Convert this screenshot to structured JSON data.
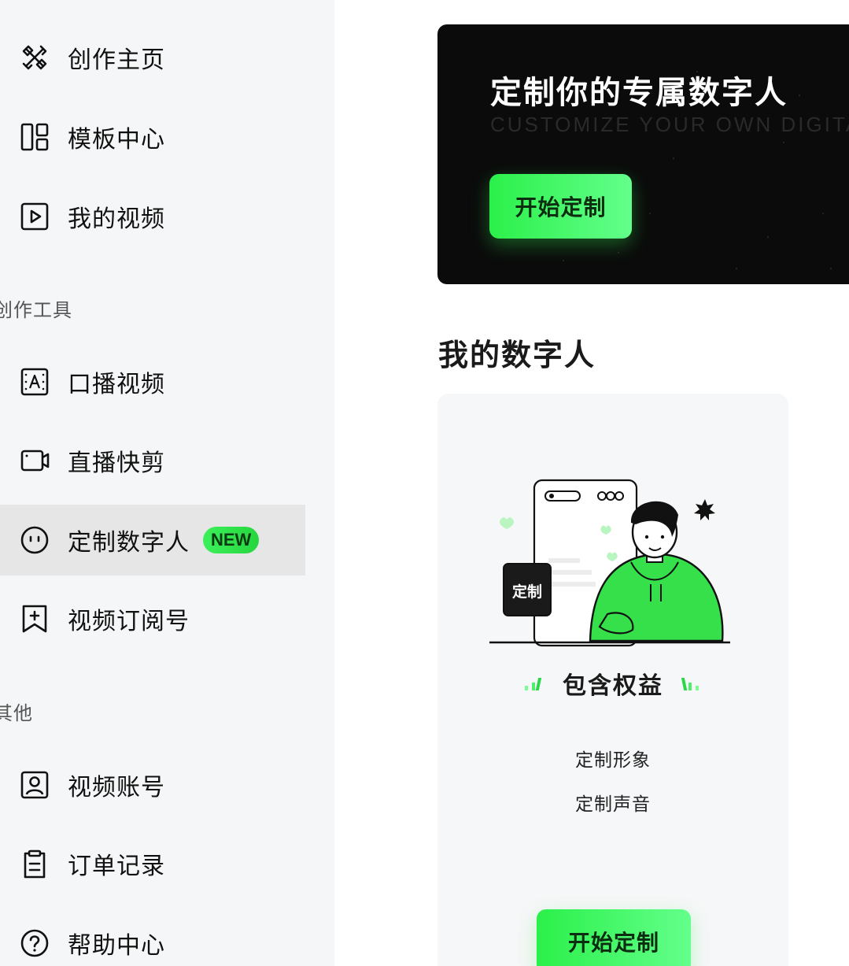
{
  "sidebar": {
    "top_items": [
      {
        "label": "创作主页",
        "icon": "creation-home-icon"
      },
      {
        "label": "模板中心",
        "icon": "template-grid-icon"
      },
      {
        "label": "我的视频",
        "icon": "play-video-icon"
      }
    ],
    "sections": [
      {
        "title": "创作工具",
        "items": [
          {
            "label": "口播视频",
            "icon": "talking-video-icon"
          },
          {
            "label": "直播快剪",
            "icon": "live-clip-camera-icon"
          },
          {
            "label": "定制数字人",
            "icon": "digital-human-face-icon",
            "badge": "NEW",
            "active": true
          },
          {
            "label": "视频订阅号",
            "icon": "bookmark-plus-icon"
          }
        ]
      },
      {
        "title": "其他",
        "items": [
          {
            "label": "视频账号",
            "icon": "account-person-icon"
          },
          {
            "label": "订单记录",
            "icon": "clipboard-order-icon"
          },
          {
            "label": "帮助中心",
            "icon": "help-question-icon"
          }
        ]
      }
    ]
  },
  "hero": {
    "title": "定制你的专属数字人",
    "subtitle": "CUSTOMIZE YOUR OWN DIGITAL PERS",
    "button": "开始定制"
  },
  "main": {
    "heading": "我的数字人",
    "card": {
      "illustration_tag": "定制",
      "benefits_title": "包含权益",
      "benefits": [
        "定制形象",
        "定制声音"
      ],
      "button": "开始定制"
    }
  },
  "colors": {
    "accent_green": "#2bf04a",
    "sidebar_bg": "#f5f6f7",
    "active_bg": "#e6e6e6",
    "hero_bg": "#0b0b0b"
  }
}
